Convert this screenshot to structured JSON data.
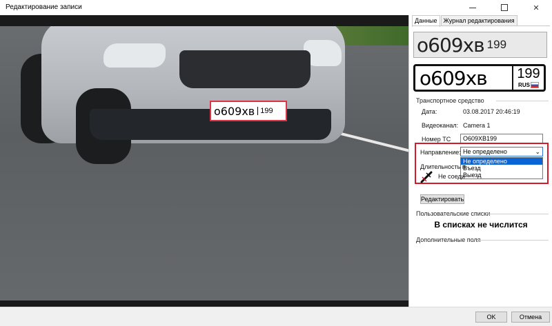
{
  "window": {
    "title": "Редактирование записи",
    "controls": {
      "minimize": "—",
      "maximize": "☐",
      "close": "✕"
    }
  },
  "video": {
    "plate_overlay": {
      "main": "о609хв",
      "region": "199"
    }
  },
  "panel": {
    "tabs": [
      {
        "label": "Данные",
        "active": true
      },
      {
        "label": "Журнал редактирования",
        "active": false
      }
    ],
    "plate_crop": {
      "main": "о609хв",
      "region": "199"
    },
    "plate_render": {
      "main": "о609хв",
      "region": "199",
      "country": "RUS"
    },
    "vehicle_section": "Транспортное средство",
    "fields": {
      "date_label": "Дата:",
      "date_value": "03.08.2017 20:46:19",
      "channel_label": "Видеоканал:",
      "channel_value": "Camera 1",
      "plate_label": "Номер ТС",
      "plate_value": "О609ХВ199",
      "direction_label": "Направление:",
      "direction_value": "Не определено",
      "duration_label": "Длительность п",
      "connection_text": "Не соеди"
    },
    "direction_options": [
      {
        "label": "Не определено",
        "selected": true
      },
      {
        "label": "Въезд",
        "selected": false
      },
      {
        "label": "Выезд",
        "selected": false
      }
    ],
    "edit_button": "Редактировать",
    "user_lists_section": "Пользовательские списки",
    "not_in_lists": "В списках не числится",
    "extra_fields_section": "Дополнительные поля"
  },
  "footer": {
    "ok": "OK",
    "cancel": "Отмена"
  },
  "colors": {
    "highlight_red": "#d41a2a",
    "select_blue": "#0a64d6"
  },
  "icons": {
    "connection": "disconnected-plug-icon"
  }
}
